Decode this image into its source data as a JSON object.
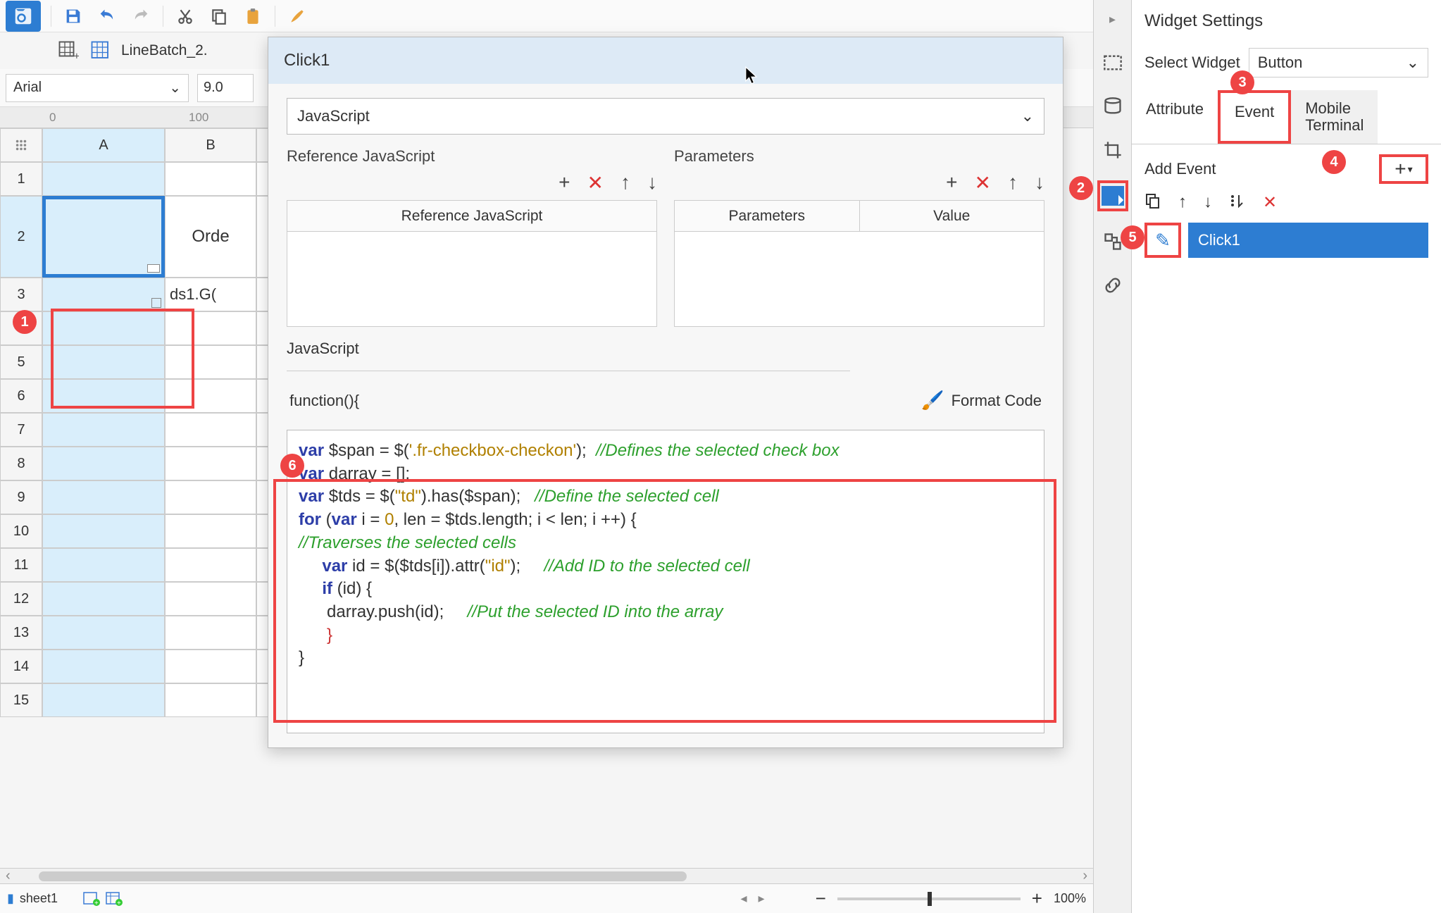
{
  "toolbar": {
    "font_name": "Arial",
    "font_size": "9.0",
    "tab_label": "LineBatch_2."
  },
  "ruler": {
    "t0": "0",
    "t100": "100"
  },
  "sheet": {
    "col_A": "A",
    "col_B": "B",
    "rows": [
      "1",
      "2",
      "3",
      "4",
      "5",
      "6",
      "7",
      "8",
      "9",
      "10",
      "11",
      "12",
      "13",
      "14",
      "15"
    ],
    "cell_b2": "Orde",
    "cell_b3": "ds1.G("
  },
  "bottom": {
    "sheet_name": "sheet1",
    "zoom": "100%"
  },
  "dialog": {
    "title": "Click1",
    "lang": "JavaScript",
    "ref_js_title": "Reference JavaScript",
    "params_title": "Parameters",
    "ref_js_col": "Reference JavaScript",
    "params_col": "Parameters",
    "value_col": "Value",
    "js_label": "JavaScript",
    "fn_label": "function(){",
    "format_code": "Format Code"
  },
  "code": {
    "l1_a": "var",
    "l1_b": " $span = $(",
    "l1_c": "'.fr-checkbox-checkon'",
    "l1_d": ");  ",
    "l1_e": "//Defines the selected check box",
    "l2_a": "var",
    "l2_b": " darray = [];",
    "l3_a": "var",
    "l3_b": " $tds = $(",
    "l3_c": "\"td\"",
    "l3_d": ").has($span);   ",
    "l3_e": "//Define the selected cell",
    "l4_a": "for",
    "l4_b": " (",
    "l4_c": "var",
    "l4_d": " i = ",
    "l4_e": "0",
    "l4_f": ", len = $tds.length; i < len; i ++) {",
    "l5": "//Traverses the selected cells",
    "l6_a": "     ",
    "l6_b": "var",
    "l6_c": " id = $($tds[i]).attr(",
    "l6_d": "\"id\"",
    "l6_e": ");     ",
    "l6_f": "//Add ID to the selected cell",
    "l7_a": "     ",
    "l7_b": "if",
    "l7_c": " (id) {",
    "l8_a": "      darray.push(id);     ",
    "l8_b": "//Put the selected ID into the array",
    "l9": "      }",
    "l10": "}"
  },
  "right": {
    "title": "Widget Settings",
    "select_widget_label": "Select Widget",
    "widget_type": "Button",
    "tab_attr": "Attribute",
    "tab_event": "Event",
    "tab_mobile_l1": "Mobile",
    "tab_mobile_l2": "Terminal",
    "add_event": "Add Event",
    "event_name": "Click1"
  },
  "badges": {
    "b1": "1",
    "b2": "2",
    "b3": "3",
    "b4": "4",
    "b5": "5",
    "b6": "6"
  }
}
